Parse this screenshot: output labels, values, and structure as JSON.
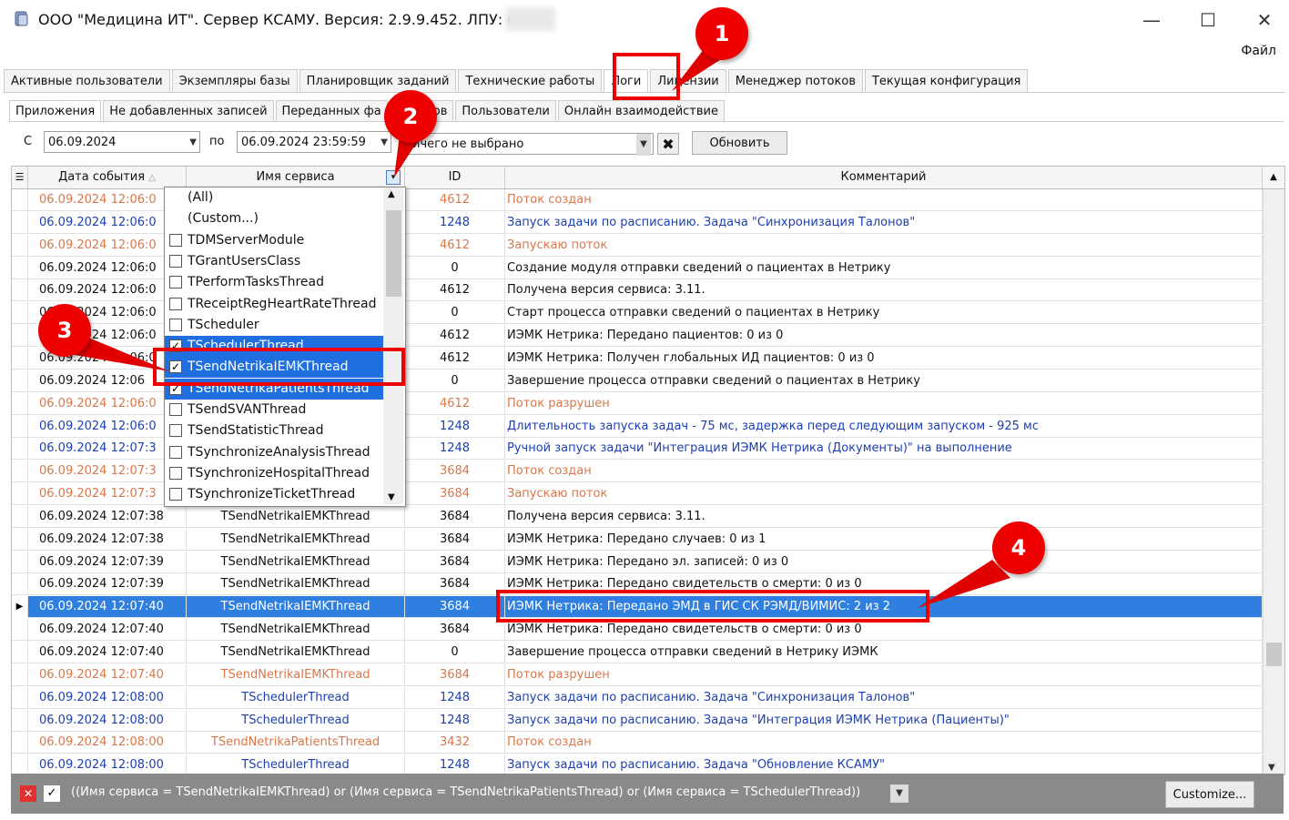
{
  "window": {
    "title": "ООО \"Медицина ИТ\". Сервер КСАМУ. Версия: 2.9.9.452. ЛПУ: ООО",
    "minimize": "—",
    "maximize": "☐",
    "close": "✕",
    "menu_file": "Файл"
  },
  "main_tabs": [
    "Активные пользователи",
    "Экземпляры базы",
    "Планировщик заданий",
    "Технические работы",
    "Логи",
    "Лицензии",
    "Менеджер потоков",
    "Текущая конфигурация"
  ],
  "sub_tabs": [
    "Приложения",
    "Не добавленных записей",
    "Переданных фа",
    "Отчётов",
    "Пользователи",
    "Онлайн взаимодействие"
  ],
  "filter": {
    "from_label": "С",
    "from_value": "06.09.2024",
    "to_label": "по",
    "to_value": "06.09.2024 23:59:59",
    "selection_value": "ичего не выбрано",
    "refresh": "Обновить"
  },
  "grid": {
    "headers": {
      "date": "Дата события",
      "service": "Имя сервиса",
      "id": "ID",
      "comment": "Комментарий"
    },
    "rows": [
      {
        "date": "06.09.2024 12:06:0",
        "service": "",
        "id": "4612",
        "comment": "Поток создан",
        "style": "orange"
      },
      {
        "date": "06.09.2024 12:06:0",
        "service": "",
        "id": "1248",
        "comment": "Запуск задачи по расписанию. Задача \"Синхронизация Талонов\"",
        "style": "blue"
      },
      {
        "date": "06.09.2024 12:06:0",
        "service": "",
        "id": "4612",
        "comment": "Запускаю поток",
        "style": "orange"
      },
      {
        "date": "06.09.2024 12:06:0",
        "service": "",
        "id": "0",
        "comment": "Создание модуля отправки сведений о пациентах в Нетрику",
        "style": "black"
      },
      {
        "date": "06.09.2024 12:06:0",
        "service": "",
        "id": "4612",
        "comment": "Получена версия сервиса: 3.11.",
        "style": "black"
      },
      {
        "date": "06.09.2024 12:06:0",
        "service": "",
        "id": "0",
        "comment": "Старт процесса отправки сведений о пациентах в Нетрику",
        "style": "black"
      },
      {
        "date": "06.09.2024 12:06:0",
        "service": "",
        "id": "4612",
        "comment": "ИЭМК Нетрика: Передано пациентов: 0 из 0",
        "style": "black"
      },
      {
        "date": "06.09.2024 12:06:0",
        "service": "",
        "id": "4612",
        "comment": "ИЭМК Нетрика: Получен глобальных ИД пациентов: 0 из 0",
        "style": "black"
      },
      {
        "date": "06.09.2024 12:06",
        "service": "",
        "id": "0",
        "comment": "Завершение процесса отправки сведений о пациентах в Нетрику",
        "style": "black"
      },
      {
        "date": "06.09.2024 12:06:0",
        "service": "",
        "id": "4612",
        "comment": "Поток разрушен",
        "style": "orange"
      },
      {
        "date": "06.09.2024 12:06:0",
        "service": "",
        "id": "1248",
        "comment": "Длительность запуска задач - 75 мс, задержка перед следующим запуском - 925 мс",
        "style": "blue"
      },
      {
        "date": "06.09.2024 12:07:3",
        "service": "",
        "id": "1248",
        "comment": "Ручной запуск задачи \"Интеграция ИЭМК Нетрика (Документы)\" на выполнение",
        "style": "blue"
      },
      {
        "date": "06.09.2024 12:07:3",
        "service": "",
        "id": "3684",
        "comment": "Поток создан",
        "style": "orange"
      },
      {
        "date": "06.09.2024 12:07:3",
        "service": "",
        "id": "3684",
        "comment": "Запускаю поток",
        "style": "orange"
      },
      {
        "date": "06.09.2024 12:07:38",
        "service": "TSendNetrikaIEMKThread",
        "id": "3684",
        "comment": "Получена версия сервиса: 3.11.",
        "style": "black"
      },
      {
        "date": "06.09.2024 12:07:38",
        "service": "TSendNetrikaIEMKThread",
        "id": "3684",
        "comment": "ИЭМК Нетрика: Передано случаев: 0 из 1",
        "style": "black"
      },
      {
        "date": "06.09.2024 12:07:39",
        "service": "TSendNetrikaIEMKThread",
        "id": "3684",
        "comment": "ИЭМК Нетрика: Передано эл. записей: 0 из 0",
        "style": "black"
      },
      {
        "date": "06.09.2024 12:07:39",
        "service": "TSendNetrikaIEMKThread",
        "id": "3684",
        "comment": "ИЭМК Нетрика: Передано свидетельств о смерти: 0 из 0",
        "style": "black"
      },
      {
        "date": "06.09.2024 12:07:40",
        "service": "TSendNetrikaIEMKThread",
        "id": "3684",
        "comment": "ИЭМК Нетрика: Передано ЭМД в ГИС СК РЭМД/ВИМИС: 2 из 2",
        "style": "selected"
      },
      {
        "date": "06.09.2024 12:07:40",
        "service": "TSendNetrikaIEMKThread",
        "id": "3684",
        "comment": "ИЭМК Нетрика: Передано свидетельств о смерти: 0 из 0",
        "style": "black"
      },
      {
        "date": "06.09.2024 12:07:40",
        "service": "TSendNetrikaIEMKThread",
        "id": "0",
        "comment": "Завершение процесса отправки сведений в Нетрику ИЭМК",
        "style": "black"
      },
      {
        "date": "06.09.2024 12:07:40",
        "service": "TSendNetrikaIEMKThread",
        "id": "3684",
        "comment": "Поток разрушен",
        "style": "orange"
      },
      {
        "date": "06.09.2024 12:08:00",
        "service": "TSchedulerThread",
        "id": "1248",
        "comment": "Запуск задачи по расписанию. Задача \"Синхронизация Талонов\"",
        "style": "blue"
      },
      {
        "date": "06.09.2024 12:08:00",
        "service": "TSchedulerThread",
        "id": "1248",
        "comment": "Запуск задачи по расписанию. Задача \"Интеграция ИЭМК Нетрика (Пациенты)\"",
        "style": "blue"
      },
      {
        "date": "06.09.2024 12:08:00",
        "service": "TSendNetrikaPatientsThread",
        "id": "3432",
        "comment": "Поток создан",
        "style": "orange"
      },
      {
        "date": "06.09.2024 12:08:00",
        "service": "TSchedulerThread",
        "id": "1248",
        "comment": "Запуск задачи по расписанию. Задача \"Обновление КСАМУ\"",
        "style": "blue"
      }
    ]
  },
  "popup_items": [
    {
      "label": "(All)",
      "checkbox": false,
      "checked": false,
      "selected": false
    },
    {
      "label": "(Custom...)",
      "checkbox": false,
      "checked": false,
      "selected": false
    },
    {
      "label": "TDMServerModule",
      "checkbox": true,
      "checked": false,
      "selected": false
    },
    {
      "label": "TGrantUsersClass",
      "checkbox": true,
      "checked": false,
      "selected": false
    },
    {
      "label": "TPerformTasksThread",
      "checkbox": true,
      "checked": false,
      "selected": false
    },
    {
      "label": "TReceiptRegHeartRateThread",
      "checkbox": true,
      "checked": false,
      "selected": false
    },
    {
      "label": "TScheduler",
      "checkbox": true,
      "checked": false,
      "selected": false
    },
    {
      "label": "TSchedulerThread",
      "checkbox": true,
      "checked": true,
      "selected": true
    },
    {
      "label": "TSendNetrikaIEMKThread",
      "checkbox": true,
      "checked": true,
      "selected": true
    },
    {
      "label": "TSendNetrikaPatientsThread",
      "checkbox": true,
      "checked": true,
      "selected": true
    },
    {
      "label": "TSendSVANThread",
      "checkbox": true,
      "checked": false,
      "selected": false
    },
    {
      "label": "TSendStatisticThread",
      "checkbox": true,
      "checked": false,
      "selected": false
    },
    {
      "label": "TSynchronizeAnalysisThread",
      "checkbox": true,
      "checked": false,
      "selected": false
    },
    {
      "label": "TSynchronizeHospitalThread",
      "checkbox": true,
      "checked": false,
      "selected": false
    },
    {
      "label": "TSynchronizeTicketThread",
      "checkbox": true,
      "checked": false,
      "selected": false
    }
  ],
  "footer": {
    "filter_text": "((Имя сервиса = TSendNetrikaIEMKThread) or (Имя сервиса = TSendNetrikaPatientsThread) or (Имя сервиса = TSchedulerThread))",
    "customize": "Customize..."
  },
  "callouts": [
    "1",
    "2",
    "3",
    "4"
  ],
  "colors": {
    "orange": "#d9774a",
    "blue": "#1c3fb0",
    "black": "#111111",
    "selected_bg": "#2f7fe0",
    "red": "#e00000"
  }
}
